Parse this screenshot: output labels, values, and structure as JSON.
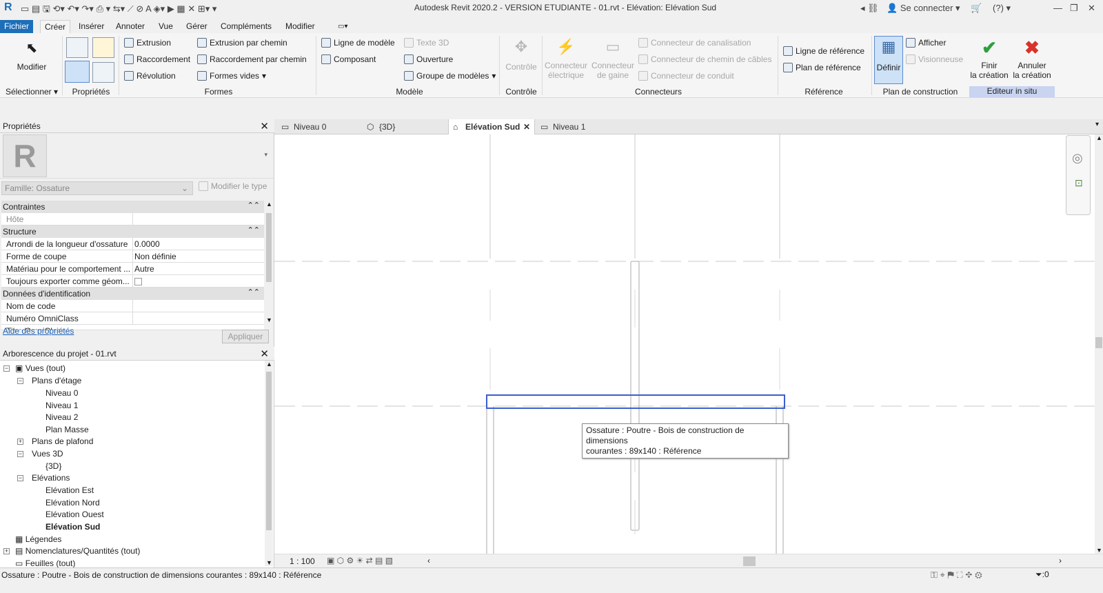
{
  "app": {
    "title": "Autodesk Revit 2020.2 - VERSION ETUDIANTE - 01.rvt - Elévation: Elévation Sud",
    "sign_in": "Se connecter",
    "help": "?"
  },
  "ribbon_tabs": [
    "Fichier",
    "Créer",
    "Insérer",
    "Annoter",
    "Vue",
    "Gérer",
    "Compléments",
    "Modifier"
  ],
  "ribbon": {
    "select": {
      "modify": "Modifier",
      "label": "Sélectionner"
    },
    "properties": {
      "label": "Propriétés"
    },
    "forms": {
      "label": "Formes",
      "items": [
        "Extrusion",
        "Raccordement",
        "Révolution",
        "Extrusion par chemin",
        "Raccordement par chemin",
        "Formes vides"
      ]
    },
    "model": {
      "label": "Modèle",
      "items": [
        "Ligne de modèle",
        "Composant",
        "Texte 3D",
        "Ouverture",
        "Groupe de modèles"
      ]
    },
    "control": {
      "label": "Contrôle",
      "button": "Contrôle"
    },
    "connectors": {
      "label": "Connecteurs",
      "electrical_1": "Connecteur",
      "electrical_2": "électrique",
      "duct_1": "Connecteur",
      "duct_2": "de gaine",
      "items": [
        "Connecteur de canalisation",
        "Connecteur de chemin de câbles",
        "Connecteur de conduit"
      ]
    },
    "reference": {
      "label": "Référence",
      "items": [
        "Ligne de référence",
        "Plan de référence"
      ]
    },
    "work_plane": {
      "label": "Plan de construction",
      "define": "Définir",
      "show": "Afficher",
      "viewer": "Visionneuse"
    },
    "in_place": {
      "label": "Editeur in situ",
      "finish_1": "Finir",
      "finish_2": "la création",
      "cancel_1": "Annuler",
      "cancel_2": "la création"
    }
  },
  "properties_panel": {
    "title": "Propriétés",
    "family": "Famille: Ossature",
    "edit_type": "Modifier le type",
    "groups": [
      {
        "name": "Contraintes"
      },
      {
        "name": "Structure"
      },
      {
        "name": "Données d'identification"
      }
    ],
    "rows": [
      {
        "key": "Hôte",
        "value": ""
      },
      {
        "key": "Arrondi de la longueur d'ossature",
        "value": "0.0000"
      },
      {
        "key": "Forme de coupe",
        "value": "Non définie"
      },
      {
        "key": "Matériau pour le comportement ...",
        "value": "Autre"
      },
      {
        "key": "Toujours exporter comme géom...",
        "value": ""
      },
      {
        "key": "Nom de code",
        "value": ""
      },
      {
        "key": "Numéro OmniClass",
        "value": ""
      },
      {
        "key": "Titre OmniClass",
        "value": ""
      }
    ],
    "help_link": "Aide des propriétés",
    "apply": "Appliquer"
  },
  "project_browser": {
    "title": "Arborescence du projet - 01.rvt",
    "items": [
      "Vues (tout)",
      "Plans d'étage",
      "Niveau 0",
      "Niveau 1",
      "Niveau 2",
      "Plan Masse",
      "Plans de plafond",
      "Vues 3D",
      "{3D}",
      "Elévations",
      "Elévation Est",
      "Elévation Nord",
      "Elévation Ouest",
      "Elévation Sud",
      "Légendes",
      "Nomenclatures/Quantités (tout)",
      "Feuilles (tout)"
    ]
  },
  "view_tabs": [
    "Niveau 0",
    "{3D}",
    "Elévation Sud",
    "Niveau 1"
  ],
  "canvas": {
    "tooltip_line1": "Ossature : Poutre - Bois de construction de dimensions",
    "tooltip_line2": "courantes : 89x140 : Référence"
  },
  "view_bar": {
    "scale": "1 : 100"
  },
  "status": {
    "text": "Ossature : Poutre - Bois de construction de dimensions courantes : 89x140 : Référence",
    "filter_count": ":0"
  },
  "colors": {
    "file_tab": "#1c6fb8",
    "selection": "#3a5fcd",
    "finish": "#2e9e3e",
    "cancel": "#d8322a"
  }
}
